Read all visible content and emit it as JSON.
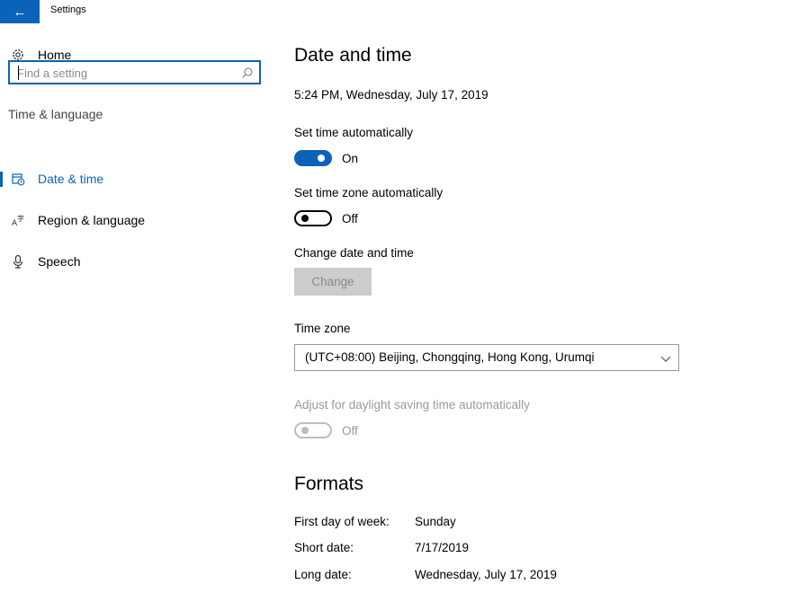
{
  "window": {
    "title": "Settings"
  },
  "sidebar": {
    "home": "Home",
    "search_placeholder": "Find a setting",
    "section": "Time & language",
    "items": [
      {
        "label": "Date & time",
        "icon": "calendar-clock-icon",
        "active": true
      },
      {
        "label": "Region & language",
        "icon": "language-icon",
        "active": false
      },
      {
        "label": "Speech",
        "icon": "microphone-icon",
        "active": false
      }
    ]
  },
  "main": {
    "title": "Date and time",
    "current_datetime": "5:24 PM, Wednesday, July 17, 2019",
    "set_time_auto": {
      "label": "Set time automatically",
      "state": "On"
    },
    "set_timezone_auto": {
      "label": "Set time zone automatically",
      "state": "Off"
    },
    "change_datetime": {
      "label": "Change date and time",
      "button": "Change"
    },
    "time_zone": {
      "label": "Time zone",
      "value": "(UTC+08:00) Beijing, Chongqing, Hong Kong, Urumqi"
    },
    "daylight": {
      "label": "Adjust for daylight saving time automatically",
      "state": "Off"
    },
    "formats": {
      "title": "Formats",
      "rows": [
        {
          "label": "First day of week:",
          "value": "Sunday"
        },
        {
          "label": "Short date:",
          "value": "7/17/2019"
        },
        {
          "label": "Long date:",
          "value": "Wednesday, July 17, 2019"
        }
      ]
    }
  },
  "colors": {
    "accent": "#0a63b8",
    "disabled": "#bdbdbd",
    "button_disabled_bg": "#cccccc"
  }
}
